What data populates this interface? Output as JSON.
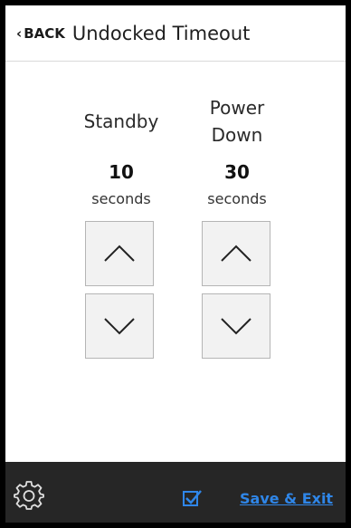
{
  "header": {
    "back_label": "BACK",
    "back_chevron": "‹",
    "title": "Undocked Timeout"
  },
  "standby": {
    "label": "Standby",
    "value": "10",
    "unit": "seconds"
  },
  "power_down": {
    "label_line1": "Power",
    "label_line2": "Down",
    "value": "30",
    "unit": "seconds"
  },
  "footer": {
    "save_label": "Save & Exit",
    "settings_icon": "gear-icon",
    "confirm_icon": "checkbox-check-icon"
  },
  "colors": {
    "accent": "#2f86e8",
    "footer_bg": "#262626",
    "button_bg": "#f2f2f2"
  }
}
